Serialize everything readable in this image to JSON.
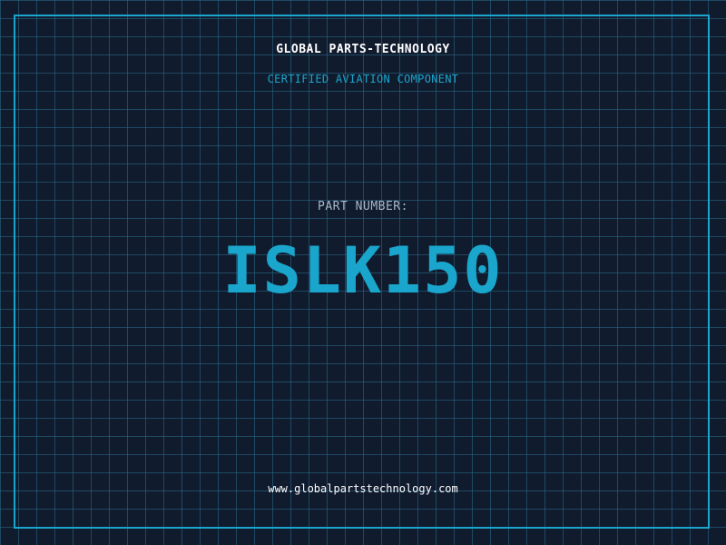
{
  "header": {
    "company": "GLOBAL PARTS-TECHNOLOGY",
    "subtitle": "CERTIFIED AVIATION COMPONENT"
  },
  "part": {
    "label": "PART NUMBER:",
    "number": "ISLK150"
  },
  "footer": {
    "url": "www.globalpartstechnology.com"
  },
  "colors": {
    "background": "#111b2e",
    "grid": "#286e8c",
    "accent": "#1aa6cc",
    "text": "#ffffff",
    "muted": "#a9b8c8"
  }
}
